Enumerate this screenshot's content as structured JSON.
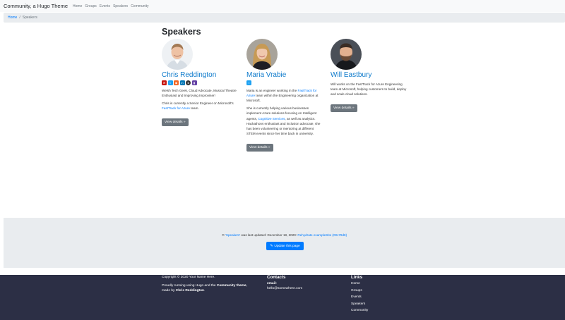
{
  "navbar": {
    "brand": "Community, a Hugo Theme",
    "links": [
      "Home",
      "Groups",
      "Events",
      "Speakers",
      "Community"
    ]
  },
  "breadcrumb": {
    "home": "Home",
    "separator": "/",
    "current": "Speakers"
  },
  "page": {
    "title": "Speakers"
  },
  "speakers": [
    {
      "name": "Chris Reddington",
      "socials": [
        {
          "icon": "email-icon",
          "color": "#c71610"
        },
        {
          "icon": "twitter-icon",
          "color": "#1da1f2"
        },
        {
          "icon": "rss-icon",
          "color": "#f26522"
        },
        {
          "icon": "linkedin-icon",
          "color": "#0077b5"
        },
        {
          "icon": "github-icon",
          "color": "#333333"
        },
        {
          "icon": "twitch-icon",
          "color": "#6441a5"
        }
      ],
      "bio_1": "Welsh Tech Geek, Cloud Advocate, Musical Theatre Enthusiast and Improving Improviser!",
      "bio_2_pre": "Chris is currently a Senior Engineer on Microsoft's ",
      "bio_2_link": "FastTrack for Azure",
      "bio_2_post": " team.",
      "button": "View details »"
    },
    {
      "name": "Maria Vrabie",
      "socials": [
        {
          "icon": "twitter-icon",
          "color": "#1da1f2"
        }
      ],
      "bio_1_pre": "Maria is an engineer working in the ",
      "bio_1_link": "FastTrack for Azure",
      "bio_1_post": " team within the Engineering organization at Microsoft.",
      "bio_2_pre": "She is currently helping various businesses implement Azure solutions focusing on Intelligent agents, ",
      "bio_2_link": "Cognitive Services",
      "bio_2_post": ", as well as analytics. Hackathons enthusiast and inclusion advocate, she has been volunteering or mentoring at different STEM events since her time back in university.",
      "button": "View details »"
    },
    {
      "name": "Will Eastbury",
      "bio_1": "Will works on the FastTrack for Azure Engineering team at Microsoft, helping customers to build, deploy and scale cloud solutions.",
      "button": "View details »"
    }
  ],
  "last_updated": {
    "link": "'Speakers'",
    "text": " was last updated: December 18, 2020: ",
    "commit": "Rehydrate exampleSite (00c79d8)",
    "button": "Update this page"
  },
  "footer": {
    "copyright": "Copyright © 2020 Your Name Here.",
    "powered_1": "Proudly running using Hugo and the ",
    "powered_theme": "Community theme",
    "powered_2": ",",
    "made_by_pre": "made by ",
    "made_by": "Chris Reddington",
    "made_by_post": ".",
    "contacts_heading": "Contacts",
    "email_label": "email:",
    "email": "hello@somewhere.com",
    "links_heading": "Links",
    "links": [
      "Home",
      "Groups",
      "Events",
      "Speakers",
      "Community"
    ]
  },
  "colors": {
    "link": "#007bff",
    "name": "#0d7acb",
    "button_secondary": "#6c757d",
    "footer_bg": "#2c2f45"
  }
}
